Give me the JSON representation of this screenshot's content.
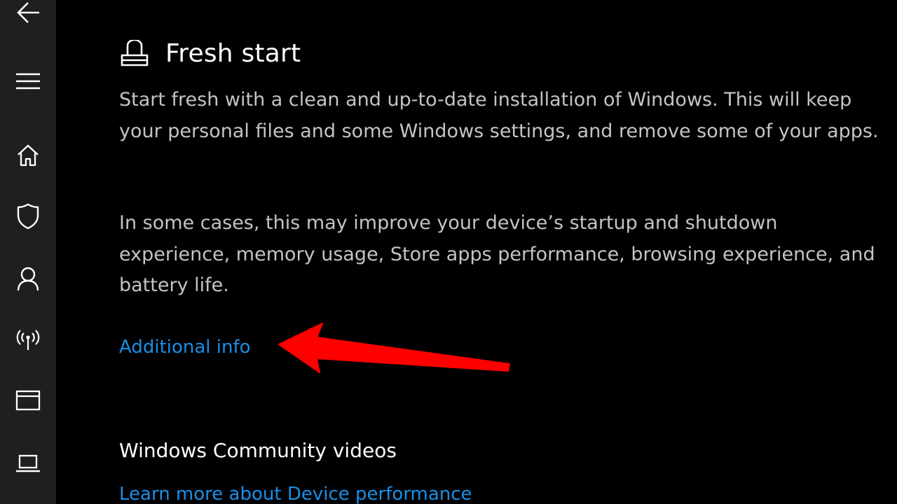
{
  "nav": {
    "back_icon": "back-arrow-icon",
    "menu_icon": "hamburger-menu-icon",
    "items": [
      {
        "icon": "home-icon"
      },
      {
        "icon": "shield-icon"
      },
      {
        "icon": "person-icon"
      },
      {
        "icon": "wireless-icon"
      },
      {
        "icon": "app-browser-icon"
      },
      {
        "icon": "laptop-icon"
      }
    ]
  },
  "main": {
    "title": "Fresh start",
    "title_icon": "fresh-start-icon",
    "paragraph1": "Start fresh with a clean and up-to-date installation of Windows. This will keep your personal files and some Windows settings, and remove some of your apps.",
    "paragraph2": "In some cases, this may improve your device’s startup and shutdown experience, memory usage, Store apps performance, browsing experience, and battery life.",
    "additional_info_link": "Additional info",
    "community_heading": "Windows Community videos",
    "learn_more_link": "Learn more about Device performance"
  },
  "annotation": {
    "type": "arrow",
    "points_to": "additional-info-link",
    "color": "#ff0000"
  },
  "colors": {
    "background": "#000000",
    "rail": "#1f1f1f",
    "link": "#1a8fe6",
    "body_text": "#c4c4c4"
  }
}
